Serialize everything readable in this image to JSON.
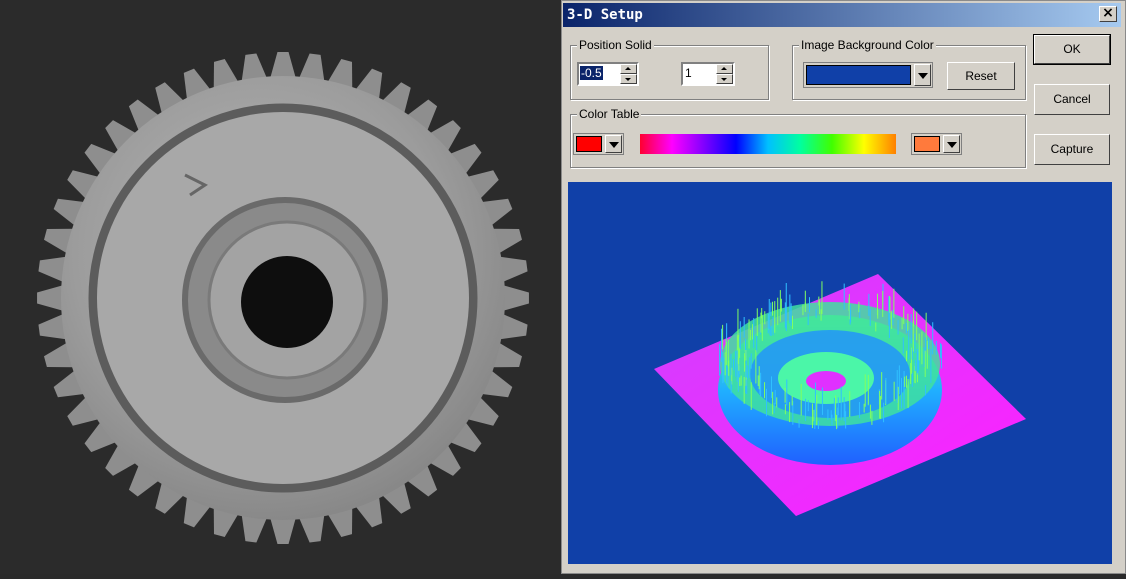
{
  "dialog": {
    "title": "3-D Setup",
    "close_label": "×"
  },
  "position_solid": {
    "label": "Position Solid",
    "value1": "-0.5",
    "value2": "1"
  },
  "background": {
    "label": "Image Background Color",
    "color": "#1040a8",
    "reset_label": "Reset"
  },
  "color_table": {
    "label": "Color Table",
    "low_color": "#ff0000",
    "high_color": "#ff7a3c"
  },
  "buttons": {
    "ok": "OK",
    "cancel": "Cancel",
    "capture": "Capture"
  }
}
